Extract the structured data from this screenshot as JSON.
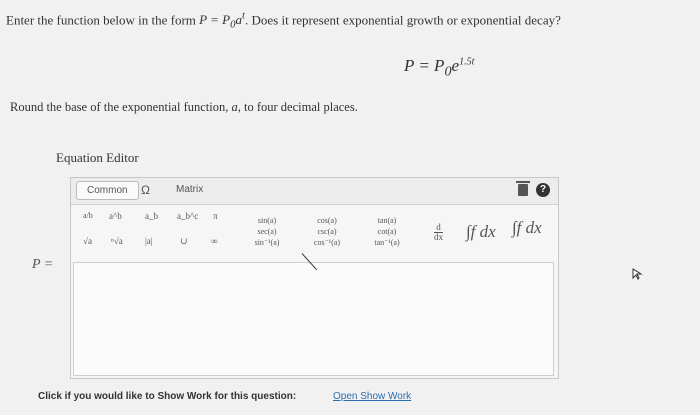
{
  "question": {
    "prefix": "Enter the function below in the form ",
    "form": "P = P",
    "form_sub": "0",
    "form_rest": "a",
    "form_sup": "t",
    "suffix": ". Does it represent exponential growth or exponential decay?"
  },
  "formula": {
    "lhs": "P = P",
    "sub": "0",
    "base": "e",
    "exp": "1.5t"
  },
  "round_instruction": {
    "text_before": "Round the base of the exponential function, ",
    "var": "a",
    "text_after": ", to four decimal places."
  },
  "editor": {
    "title": "Equation Editor",
    "tabs": {
      "common": "Common",
      "omega": "Ω",
      "matrix": "Matrix"
    },
    "help_label": "?",
    "tools": {
      "frac": "a/b",
      "power": "a^b",
      "sub": "a_b",
      "subsup": "a_b^c",
      "pi": "π",
      "sqrt": "√a",
      "nthroot": "ⁿ√a",
      "abs": "|a|",
      "union": "∪",
      "infinity": "∞"
    },
    "trig": {
      "col1": [
        "sin(a)",
        "sec(a)",
        "sin⁻¹(a)"
      ],
      "col2": [
        "cos(a)",
        "csc(a)",
        "cos⁻¹(a)"
      ],
      "col3": [
        "tan(a)",
        "cot(a)",
        "tan⁻¹(a)"
      ]
    },
    "deriv_top": "d",
    "deriv_bottom": "dx",
    "integral": "∫f dx",
    "integral_def": "∫f dx"
  },
  "answer_label": "P =",
  "show_work": {
    "prompt": "Click if you would like to Show Work for this question:",
    "link": "Open Show Work"
  }
}
